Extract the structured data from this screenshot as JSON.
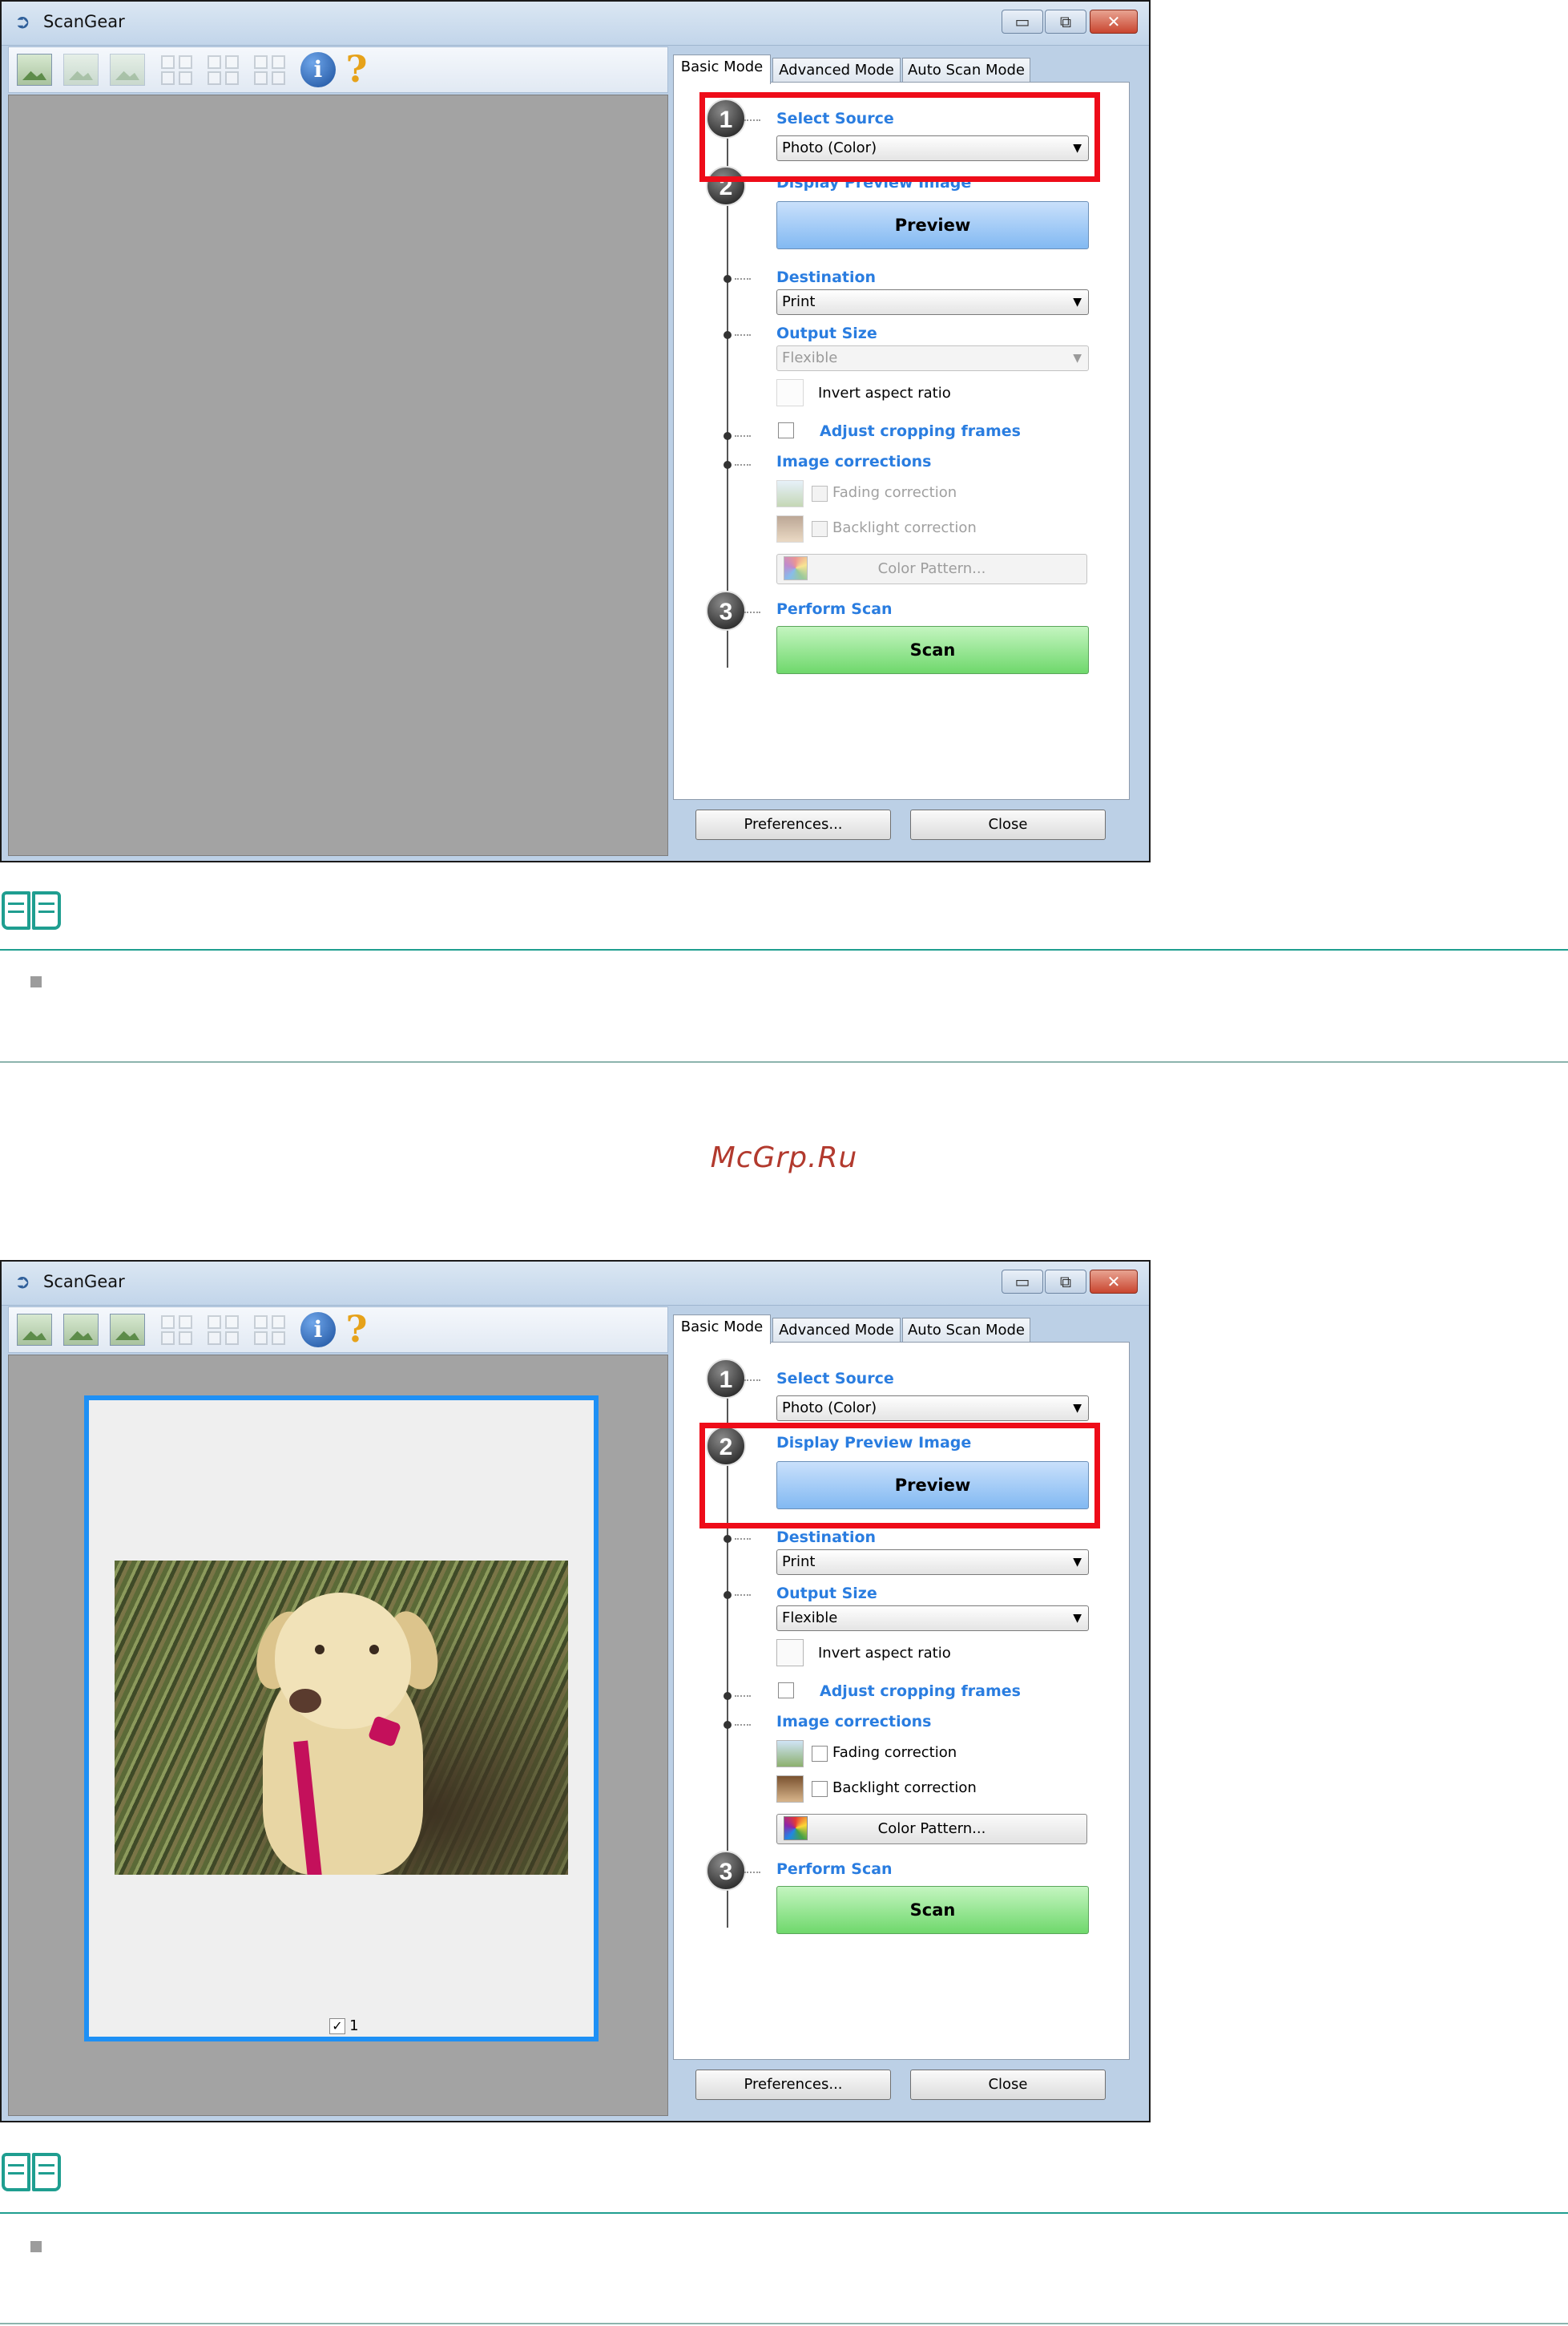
{
  "window": {
    "title": "ScanGear",
    "app_icon": "scangear-arrow-icon",
    "controls": {
      "minimize": "▭",
      "maximize": "⧉",
      "close": "✕"
    }
  },
  "toolbar": {
    "icons": [
      "scan-image-icon",
      "image-a-icon",
      "image-b-icon",
      "frame-grid-2-icon",
      "frame-grid-4-icon",
      "frame-grid-6-icon",
      "info-icon",
      "help-icon"
    ],
    "info_glyph": "i",
    "help_glyph": "?"
  },
  "tabs": [
    "Basic Mode",
    "Advanced Mode",
    "Auto Scan Mode"
  ],
  "steps": {
    "one": "1",
    "two": "2",
    "three": "3"
  },
  "labels": {
    "select_source": "Select Source",
    "display_preview": "Display Preview Image",
    "destination": "Destination",
    "output_size": "Output Size",
    "adjust_cropping": "Adjust cropping frames",
    "image_corrections": "Image corrections",
    "perform_scan": "Perform Scan",
    "invert_aspect": "Invert aspect ratio",
    "fading": "Fading correction",
    "backlight": "Backlight correction"
  },
  "values": {
    "source": "Photo (Color)",
    "destination": "Print",
    "output_size": "Flexible"
  },
  "buttons": {
    "preview": "Preview",
    "color_pattern": "Color Pattern...",
    "scan": "Scan",
    "preferences": "Preferences...",
    "close": "Close"
  },
  "dropdown_arrow": "▼",
  "frame": {
    "checkbox": "✓",
    "label": "1"
  },
  "watermark": "McGrp.Ru",
  "colors": {
    "highlight": "#ee0c19",
    "label_blue": "#2a7de0",
    "note_teal": "#1f9e90",
    "frame_blue": "#1e90f5"
  }
}
